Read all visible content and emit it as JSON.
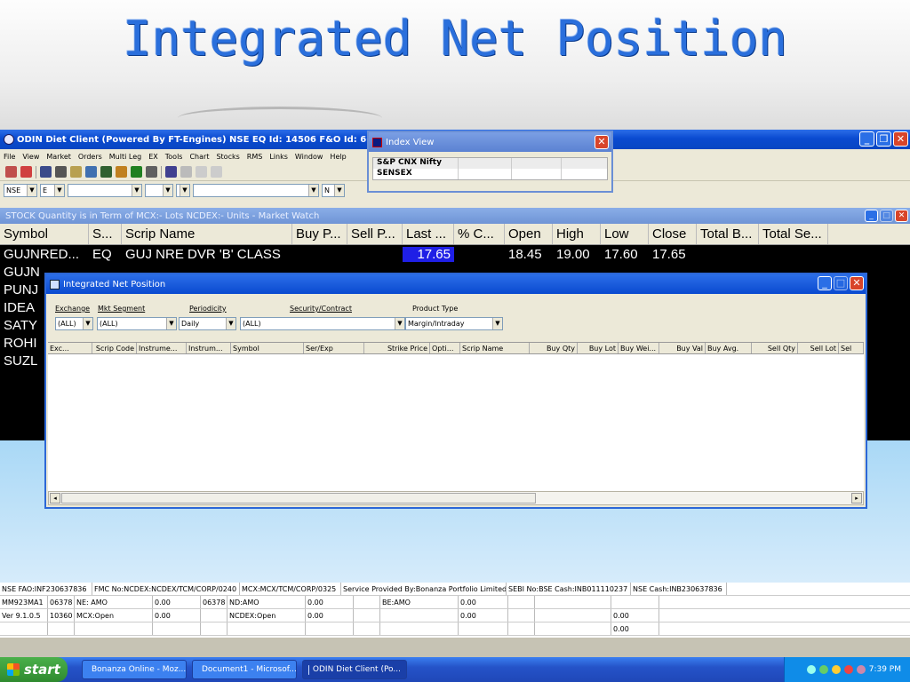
{
  "slide": {
    "title": "Integrated Net Position"
  },
  "app": {
    "title": "ODIN Diet Client  (Powered By FT-Engines)  NSE EQ Id: 14506  F&O Id: 669",
    "menu": [
      "File",
      "View",
      "Market",
      "Orders",
      "Multi Leg",
      "EX",
      "Tools",
      "Chart",
      "Stocks",
      "RMS",
      "Links",
      "Window",
      "Help"
    ],
    "filter": {
      "exchange": "NSE",
      "segment": "E",
      "c3": "",
      "c4": "",
      "c5": "",
      "c6": "",
      "series": "N"
    }
  },
  "index_view": {
    "title": "Index View",
    "rows": [
      "S&P CNX Nifty",
      "SENSEX"
    ]
  },
  "market_watch": {
    "title": "STOCK   Quantity is in Term of  MCX:- Lots  NCDEX:- Units - Market Watch",
    "headers": [
      "Symbol",
      "S...",
      "Scrip Name",
      "Buy P...",
      "Sell P...",
      "Last ...",
      "% C...",
      "Open",
      "High",
      "Low",
      "Close",
      "Total B...",
      "Total Se..."
    ],
    "rows": [
      {
        "symbol": "GUJNRED...",
        "series": "EQ",
        "name": "GUJ NRE DVR 'B' CLASS",
        "buy": "",
        "sell": "",
        "last": "17.65",
        "chg": "",
        "open": "18.45",
        "high": "19.00",
        "low": "17.60",
        "close": "17.65",
        "tb": "",
        "ts": ""
      },
      {
        "symbol": "GUJN",
        "series": "",
        "name": "",
        "buy": "",
        "sell": "",
        "last": "",
        "chg": "",
        "open": "",
        "high": "",
        "low": "",
        "close": "",
        "tb": "",
        "ts": ""
      },
      {
        "symbol": "PUNJ",
        "series": "",
        "name": "",
        "buy": "",
        "sell": "",
        "last": "",
        "chg": "",
        "open": "",
        "high": "",
        "low": "",
        "close": "",
        "tb": "",
        "ts": ""
      },
      {
        "symbol": "IDEA",
        "series": "",
        "name": "",
        "buy": "",
        "sell": "",
        "last": "",
        "chg": "",
        "open": "",
        "high": "",
        "low": "",
        "close": "",
        "tb": "",
        "ts": ""
      },
      {
        "symbol": "SATY",
        "series": "",
        "name": "",
        "buy": "",
        "sell": "",
        "last": "",
        "chg": "",
        "open": "",
        "high": "",
        "low": "",
        "close": "",
        "tb": "",
        "ts": ""
      },
      {
        "symbol": "ROHI",
        "series": "",
        "name": "",
        "buy": "",
        "sell": "",
        "last": "",
        "chg": "",
        "open": "",
        "high": "",
        "low": "",
        "close": "",
        "tb": "",
        "ts": ""
      },
      {
        "symbol": "SUZL",
        "series": "",
        "name": "",
        "buy": "",
        "sell": "",
        "last": "",
        "chg": "",
        "open": "",
        "high": "",
        "low": "",
        "close": "",
        "tb": "",
        "ts": ""
      }
    ]
  },
  "inp": {
    "title": "Integrated Net Position",
    "labels": {
      "exchange": "Exchange",
      "segment": "Mkt Segment",
      "periodicity": "Periodicity",
      "security": "Security/Contract",
      "product": "Product Type"
    },
    "values": {
      "exchange": "(ALL)",
      "segment": "(ALL)",
      "periodicity": "Daily",
      "security": "(ALL)",
      "product": "Margin/Intraday"
    },
    "columns": [
      "Exc...",
      "Scrip Code",
      "Instrume...",
      "Instrum...",
      "Symbol",
      "Ser/Exp",
      "Strike Price",
      "Opti...",
      "Scrip Name",
      "Buy Qty",
      "Buy Lot",
      "Buy Wei...",
      "Buy Val",
      "Buy Avg.",
      "Sell Qty",
      "Sell Lot",
      "Sel"
    ]
  },
  "status": {
    "row1": [
      "NSE FAO:INF230637836",
      "FMC No:NCDEX:NCDEX/TCM/CORP/0240",
      "MCX:MCX/TCM/CORP/0325",
      "Service Provided By:Bonanza Portfolio Limited",
      "SEBI No:BSE Cash:INB011110237",
      "NSE Cash:INB230637836"
    ],
    "row2": [
      "MM923MA1",
      "06378",
      "NE: AMO",
      "0.00",
      "06378",
      "ND:AMO",
      "0.00",
      "",
      "BE:AMO",
      "0.00",
      "",
      "",
      "",
      ""
    ],
    "row3": [
      "Ver 9.1.0.5",
      "10360",
      "MCX:Open",
      "0.00",
      "",
      "NCDEX:Open",
      "0.00",
      "",
      "",
      "0.00",
      "",
      "",
      "0.00",
      ""
    ],
    "row4": [
      "",
      "",
      "",
      "",
      "",
      "",
      "",
      "",
      "",
      "",
      "",
      "",
      "0.00",
      ""
    ]
  },
  "taskbar": {
    "start": "start",
    "tasks": [
      "Bonanza Online - Moz...",
      "Document1 - Microsof...",
      "ODIN Diet Client  (Po..."
    ],
    "time": "7:39 PM"
  }
}
